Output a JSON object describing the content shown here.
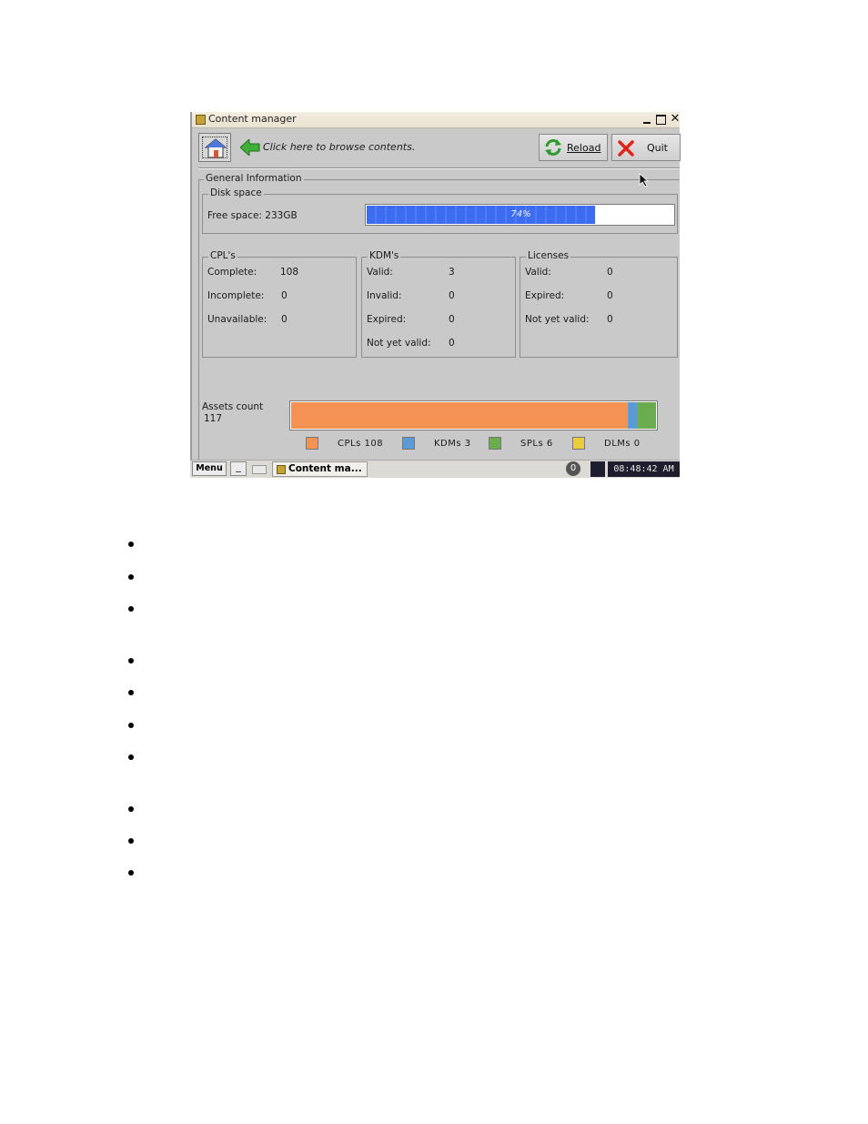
{
  "window": {
    "title": "Content manager",
    "min_glyph": "_",
    "close_glyph": "✕"
  },
  "toolbar": {
    "browse_hint": "Click here to browse contents.",
    "reload_label": "Reload",
    "quit_label": "Quit"
  },
  "general": {
    "title": "General Information",
    "disk": {
      "title": "Disk space",
      "free_label": "Free space: 233GB",
      "used_percent": 74,
      "used_text": "74%"
    },
    "cpls": {
      "title": "CPL's",
      "rows": [
        {
          "label": "Complete:",
          "value": "108"
        },
        {
          "label": "Incomplete:",
          "value": "0"
        },
        {
          "label": "Unavailable:",
          "value": "0"
        }
      ]
    },
    "kdms": {
      "title": "KDM's",
      "rows": [
        {
          "label": "Valid:",
          "value": "3"
        },
        {
          "label": "Invalid:",
          "value": "0"
        },
        {
          "label": "Expired:",
          "value": "0"
        },
        {
          "label": "Not yet valid:",
          "value": "0"
        }
      ]
    },
    "licenses": {
      "title": "Licenses",
      "rows": [
        {
          "label": "Valid:",
          "value": "0"
        },
        {
          "label": "Expired:",
          "value": "0"
        },
        {
          "label": "Not yet valid:",
          "value": "0"
        }
      ]
    },
    "assets": {
      "label": "Assets count",
      "total": "117",
      "segments": [
        {
          "name": "CPLs",
          "value": 108,
          "color": "#f39252",
          "text": "CPLs  108"
        },
        {
          "name": "KDMs",
          "value": 3,
          "color": "#5a9ad8",
          "text": "KDMs  3"
        },
        {
          "name": "SPLs",
          "value": 6,
          "color": "#6aac4e",
          "text": "SPLs  6"
        },
        {
          "name": "DLMs",
          "value": 0,
          "color": "#e8cf3a",
          "text": "DLMs  0"
        }
      ]
    }
  },
  "taskbar": {
    "menu_label": "Menu",
    "min_label": "_",
    "task_label": "Content ma...",
    "badge": "0",
    "clock": "08:48:42 AM"
  },
  "colors": {
    "progress_fill": "#3d6cf0",
    "window_bg": "#c9c9c9"
  }
}
